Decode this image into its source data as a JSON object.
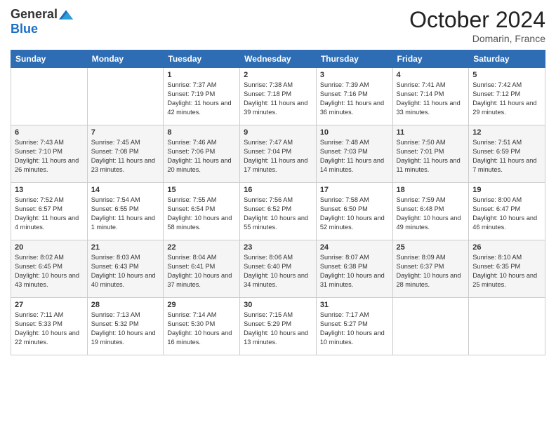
{
  "logo": {
    "general": "General",
    "blue": "Blue"
  },
  "title": "October 2024",
  "location": "Domarin, France",
  "days_of_week": [
    "Sunday",
    "Monday",
    "Tuesday",
    "Wednesday",
    "Thursday",
    "Friday",
    "Saturday"
  ],
  "weeks": [
    [
      {
        "day": "",
        "sunrise": "",
        "sunset": "",
        "daylight": ""
      },
      {
        "day": "",
        "sunrise": "",
        "sunset": "",
        "daylight": ""
      },
      {
        "day": "1",
        "sunrise": "Sunrise: 7:37 AM",
        "sunset": "Sunset: 7:19 PM",
        "daylight": "Daylight: 11 hours and 42 minutes."
      },
      {
        "day": "2",
        "sunrise": "Sunrise: 7:38 AM",
        "sunset": "Sunset: 7:18 PM",
        "daylight": "Daylight: 11 hours and 39 minutes."
      },
      {
        "day": "3",
        "sunrise": "Sunrise: 7:39 AM",
        "sunset": "Sunset: 7:16 PM",
        "daylight": "Daylight: 11 hours and 36 minutes."
      },
      {
        "day": "4",
        "sunrise": "Sunrise: 7:41 AM",
        "sunset": "Sunset: 7:14 PM",
        "daylight": "Daylight: 11 hours and 33 minutes."
      },
      {
        "day": "5",
        "sunrise": "Sunrise: 7:42 AM",
        "sunset": "Sunset: 7:12 PM",
        "daylight": "Daylight: 11 hours and 29 minutes."
      }
    ],
    [
      {
        "day": "6",
        "sunrise": "Sunrise: 7:43 AM",
        "sunset": "Sunset: 7:10 PM",
        "daylight": "Daylight: 11 hours and 26 minutes."
      },
      {
        "day": "7",
        "sunrise": "Sunrise: 7:45 AM",
        "sunset": "Sunset: 7:08 PM",
        "daylight": "Daylight: 11 hours and 23 minutes."
      },
      {
        "day": "8",
        "sunrise": "Sunrise: 7:46 AM",
        "sunset": "Sunset: 7:06 PM",
        "daylight": "Daylight: 11 hours and 20 minutes."
      },
      {
        "day": "9",
        "sunrise": "Sunrise: 7:47 AM",
        "sunset": "Sunset: 7:04 PM",
        "daylight": "Daylight: 11 hours and 17 minutes."
      },
      {
        "day": "10",
        "sunrise": "Sunrise: 7:48 AM",
        "sunset": "Sunset: 7:03 PM",
        "daylight": "Daylight: 11 hours and 14 minutes."
      },
      {
        "day": "11",
        "sunrise": "Sunrise: 7:50 AM",
        "sunset": "Sunset: 7:01 PM",
        "daylight": "Daylight: 11 hours and 11 minutes."
      },
      {
        "day": "12",
        "sunrise": "Sunrise: 7:51 AM",
        "sunset": "Sunset: 6:59 PM",
        "daylight": "Daylight: 11 hours and 7 minutes."
      }
    ],
    [
      {
        "day": "13",
        "sunrise": "Sunrise: 7:52 AM",
        "sunset": "Sunset: 6:57 PM",
        "daylight": "Daylight: 11 hours and 4 minutes."
      },
      {
        "day": "14",
        "sunrise": "Sunrise: 7:54 AM",
        "sunset": "Sunset: 6:55 PM",
        "daylight": "Daylight: 11 hours and 1 minute."
      },
      {
        "day": "15",
        "sunrise": "Sunrise: 7:55 AM",
        "sunset": "Sunset: 6:54 PM",
        "daylight": "Daylight: 10 hours and 58 minutes."
      },
      {
        "day": "16",
        "sunrise": "Sunrise: 7:56 AM",
        "sunset": "Sunset: 6:52 PM",
        "daylight": "Daylight: 10 hours and 55 minutes."
      },
      {
        "day": "17",
        "sunrise": "Sunrise: 7:58 AM",
        "sunset": "Sunset: 6:50 PM",
        "daylight": "Daylight: 10 hours and 52 minutes."
      },
      {
        "day": "18",
        "sunrise": "Sunrise: 7:59 AM",
        "sunset": "Sunset: 6:48 PM",
        "daylight": "Daylight: 10 hours and 49 minutes."
      },
      {
        "day": "19",
        "sunrise": "Sunrise: 8:00 AM",
        "sunset": "Sunset: 6:47 PM",
        "daylight": "Daylight: 10 hours and 46 minutes."
      }
    ],
    [
      {
        "day": "20",
        "sunrise": "Sunrise: 8:02 AM",
        "sunset": "Sunset: 6:45 PM",
        "daylight": "Daylight: 10 hours and 43 minutes."
      },
      {
        "day": "21",
        "sunrise": "Sunrise: 8:03 AM",
        "sunset": "Sunset: 6:43 PM",
        "daylight": "Daylight: 10 hours and 40 minutes."
      },
      {
        "day": "22",
        "sunrise": "Sunrise: 8:04 AM",
        "sunset": "Sunset: 6:41 PM",
        "daylight": "Daylight: 10 hours and 37 minutes."
      },
      {
        "day": "23",
        "sunrise": "Sunrise: 8:06 AM",
        "sunset": "Sunset: 6:40 PM",
        "daylight": "Daylight: 10 hours and 34 minutes."
      },
      {
        "day": "24",
        "sunrise": "Sunrise: 8:07 AM",
        "sunset": "Sunset: 6:38 PM",
        "daylight": "Daylight: 10 hours and 31 minutes."
      },
      {
        "day": "25",
        "sunrise": "Sunrise: 8:09 AM",
        "sunset": "Sunset: 6:37 PM",
        "daylight": "Daylight: 10 hours and 28 minutes."
      },
      {
        "day": "26",
        "sunrise": "Sunrise: 8:10 AM",
        "sunset": "Sunset: 6:35 PM",
        "daylight": "Daylight: 10 hours and 25 minutes."
      }
    ],
    [
      {
        "day": "27",
        "sunrise": "Sunrise: 7:11 AM",
        "sunset": "Sunset: 5:33 PM",
        "daylight": "Daylight: 10 hours and 22 minutes."
      },
      {
        "day": "28",
        "sunrise": "Sunrise: 7:13 AM",
        "sunset": "Sunset: 5:32 PM",
        "daylight": "Daylight: 10 hours and 19 minutes."
      },
      {
        "day": "29",
        "sunrise": "Sunrise: 7:14 AM",
        "sunset": "Sunset: 5:30 PM",
        "daylight": "Daylight: 10 hours and 16 minutes."
      },
      {
        "day": "30",
        "sunrise": "Sunrise: 7:15 AM",
        "sunset": "Sunset: 5:29 PM",
        "daylight": "Daylight: 10 hours and 13 minutes."
      },
      {
        "day": "31",
        "sunrise": "Sunrise: 7:17 AM",
        "sunset": "Sunset: 5:27 PM",
        "daylight": "Daylight: 10 hours and 10 minutes."
      },
      {
        "day": "",
        "sunrise": "",
        "sunset": "",
        "daylight": ""
      },
      {
        "day": "",
        "sunrise": "",
        "sunset": "",
        "daylight": ""
      }
    ]
  ]
}
